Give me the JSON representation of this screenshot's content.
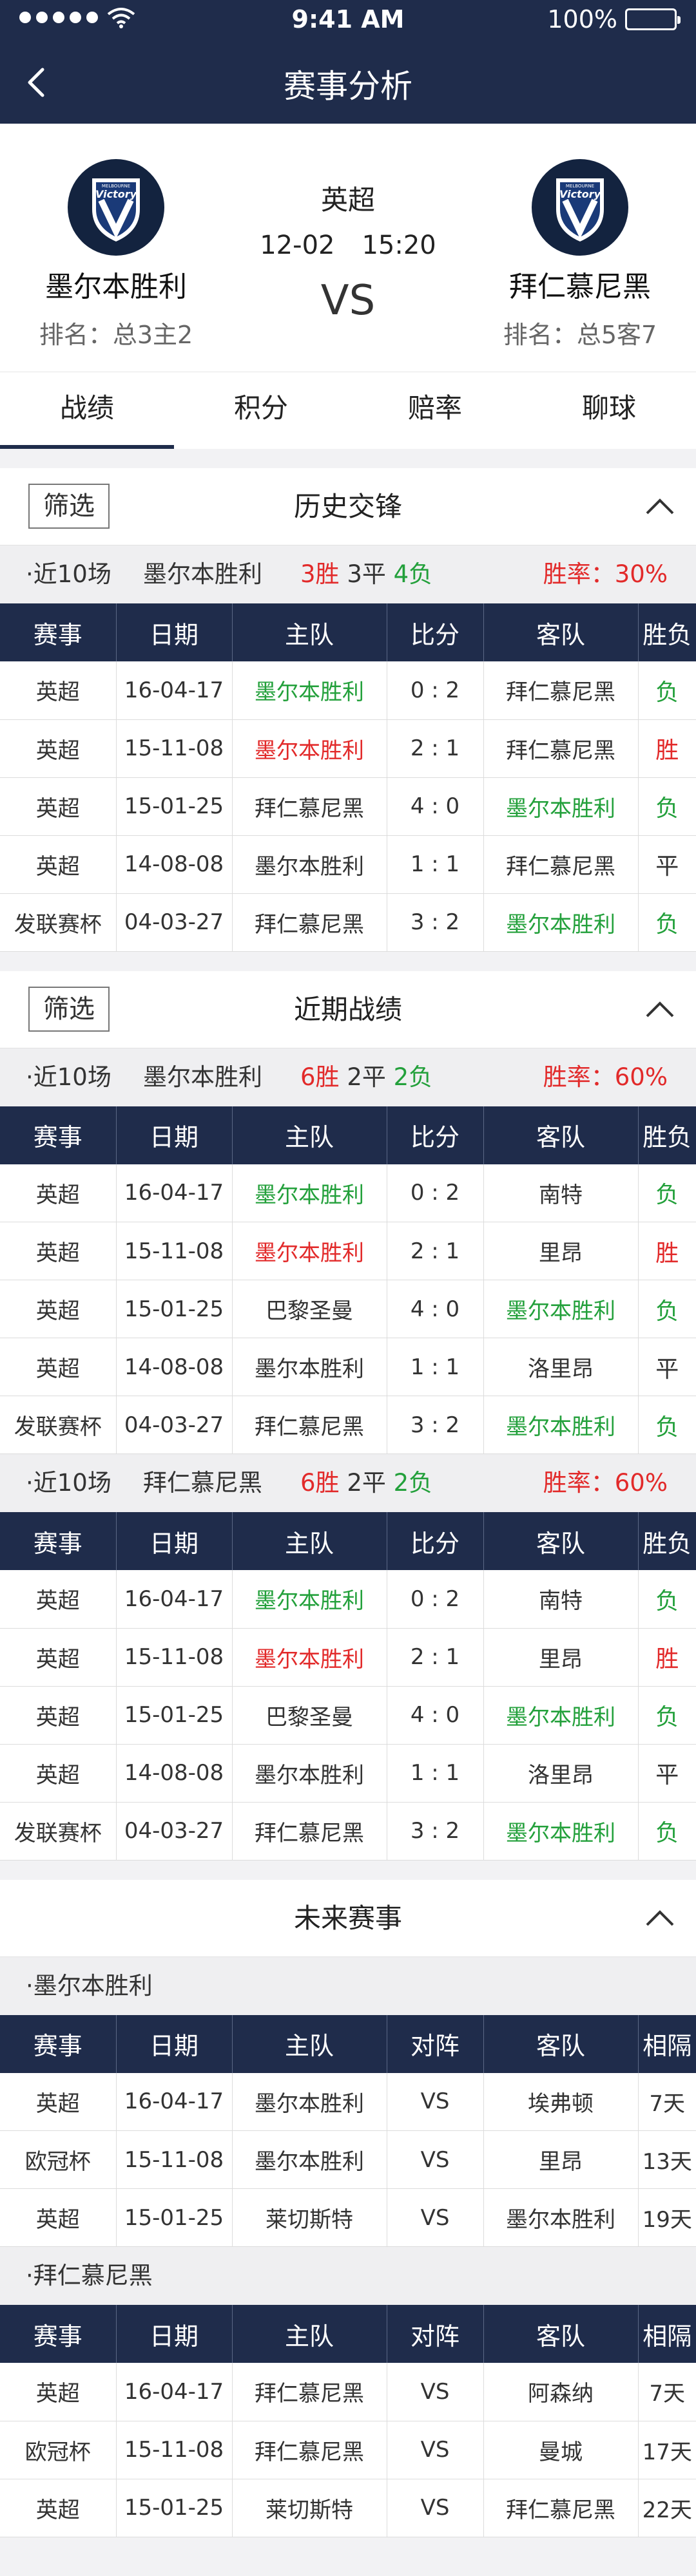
{
  "status_bar": {
    "time": "9:41 AM",
    "battery": "100%"
  },
  "nav": {
    "title": "赛事分析"
  },
  "match": {
    "home": {
      "name": "墨尔本胜利",
      "rank": "排名：总3主2",
      "logo_text": "Victory",
      "logo_small": "MELBOURNE"
    },
    "away": {
      "name": "拜仁慕尼黑",
      "rank": "排名：总5客7",
      "logo_text": "Victory",
      "logo_small": "MELBOURNE"
    },
    "league": "英超",
    "date": "12-02",
    "time": "15:20",
    "vs": "VS"
  },
  "tabs": [
    "战绩",
    "积分",
    "赔率",
    "聊球"
  ],
  "filter_label": "筛选",
  "colors": {
    "navy": "#1f2c4b",
    "win": "#e22a2a",
    "lose": "#23a03b"
  },
  "history": {
    "title": "历史交锋",
    "summary": {
      "last": "·近10场",
      "team": "墨尔本胜利",
      "w": "3胜",
      "d": "3平",
      "l": "4负",
      "rate": "胜率：30%"
    },
    "headers": [
      "赛事",
      "日期",
      "主队",
      "比分",
      "客队",
      "胜负"
    ],
    "rows": [
      {
        "league": "英超",
        "date": "16-04-17",
        "home": "墨尔本胜利",
        "home_c": "lose",
        "score": "0 : 2",
        "away": "拜仁慕尼黑",
        "away_c": "",
        "result": "负",
        "res_c": "lose"
      },
      {
        "league": "英超",
        "date": "15-11-08",
        "home": "墨尔本胜利",
        "home_c": "win",
        "score": "2 : 1",
        "away": "拜仁慕尼黑",
        "away_c": "",
        "result": "胜",
        "res_c": "win"
      },
      {
        "league": "英超",
        "date": "15-01-25",
        "home": "拜仁慕尼黑",
        "home_c": "",
        "score": "4 : 0",
        "away": "墨尔本胜利",
        "away_c": "lose",
        "result": "负",
        "res_c": "lose"
      },
      {
        "league": "英超",
        "date": "14-08-08",
        "home": "墨尔本胜利",
        "home_c": "",
        "score": "1 : 1",
        "away": "拜仁慕尼黑",
        "away_c": "",
        "result": "平",
        "res_c": "draw"
      },
      {
        "league": "发联赛杯",
        "date": "04-03-27",
        "home": "拜仁慕尼黑",
        "home_c": "",
        "score": "3 : 2",
        "away": "墨尔本胜利",
        "away_c": "lose",
        "result": "负",
        "res_c": "lose"
      }
    ]
  },
  "recent": {
    "title": "近期战绩",
    "groups": [
      {
        "summary": {
          "last": "·近10场",
          "team": "墨尔本胜利",
          "w": "6胜",
          "d": "2平",
          "l": "2负",
          "rate": "胜率：60%"
        },
        "headers": [
          "赛事",
          "日期",
          "主队",
          "比分",
          "客队",
          "胜负"
        ],
        "rows": [
          {
            "league": "英超",
            "date": "16-04-17",
            "home": "墨尔本胜利",
            "home_c": "lose",
            "score": "0 : 2",
            "away": "南特",
            "away_c": "",
            "result": "负",
            "res_c": "lose"
          },
          {
            "league": "英超",
            "date": "15-11-08",
            "home": "墨尔本胜利",
            "home_c": "win",
            "score": "2 : 1",
            "away": "里昂",
            "away_c": "",
            "result": "胜",
            "res_c": "win"
          },
          {
            "league": "英超",
            "date": "15-01-25",
            "home": "巴黎圣曼",
            "home_c": "",
            "score": "4 : 0",
            "away": "墨尔本胜利",
            "away_c": "lose",
            "result": "负",
            "res_c": "lose"
          },
          {
            "league": "英超",
            "date": "14-08-08",
            "home": "墨尔本胜利",
            "home_c": "",
            "score": "1 : 1",
            "away": "洛里昂",
            "away_c": "",
            "result": "平",
            "res_c": "draw"
          },
          {
            "league": "发联赛杯",
            "date": "04-03-27",
            "home": "拜仁慕尼黑",
            "home_c": "",
            "score": "3 : 2",
            "away": "墨尔本胜利",
            "away_c": "lose",
            "result": "负",
            "res_c": "lose"
          }
        ]
      },
      {
        "summary": {
          "last": "·近10场",
          "team": "拜仁慕尼黑",
          "w": "6胜",
          "d": "2平",
          "l": "2负",
          "rate": "胜率：60%"
        },
        "headers": [
          "赛事",
          "日期",
          "主队",
          "比分",
          "客队",
          "胜负"
        ],
        "rows": [
          {
            "league": "英超",
            "date": "16-04-17",
            "home": "墨尔本胜利",
            "home_c": "lose",
            "score": "0 : 2",
            "away": "南特",
            "away_c": "",
            "result": "负",
            "res_c": "lose"
          },
          {
            "league": "英超",
            "date": "15-11-08",
            "home": "墨尔本胜利",
            "home_c": "win",
            "score": "2 : 1",
            "away": "里昂",
            "away_c": "",
            "result": "胜",
            "res_c": "win"
          },
          {
            "league": "英超",
            "date": "15-01-25",
            "home": "巴黎圣曼",
            "home_c": "",
            "score": "4 : 0",
            "away": "墨尔本胜利",
            "away_c": "lose",
            "result": "负",
            "res_c": "lose"
          },
          {
            "league": "英超",
            "date": "14-08-08",
            "home": "墨尔本胜利",
            "home_c": "",
            "score": "1 : 1",
            "away": "洛里昂",
            "away_c": "",
            "result": "平",
            "res_c": "draw"
          },
          {
            "league": "发联赛杯",
            "date": "04-03-27",
            "home": "拜仁慕尼黑",
            "home_c": "",
            "score": "3 : 2",
            "away": "墨尔本胜利",
            "away_c": "lose",
            "result": "负",
            "res_c": "lose"
          }
        ]
      }
    ]
  },
  "future": {
    "title": "未来赛事",
    "groups": [
      {
        "label": "·墨尔本胜利",
        "headers": [
          "赛事",
          "日期",
          "主队",
          "对阵",
          "客队",
          "相隔"
        ],
        "rows": [
          {
            "league": "英超",
            "date": "16-04-17",
            "home": "墨尔本胜利",
            "vs": "VS",
            "away": "埃弗顿",
            "gap": "7天"
          },
          {
            "league": "欧冠杯",
            "date": "15-11-08",
            "home": "墨尔本胜利",
            "vs": "VS",
            "away": "里昂",
            "gap": "13天"
          },
          {
            "league": "英超",
            "date": "15-01-25",
            "home": "莱切斯特",
            "vs": "VS",
            "away": "墨尔本胜利",
            "gap": "19天"
          }
        ]
      },
      {
        "label": "·拜仁慕尼黑",
        "headers": [
          "赛事",
          "日期",
          "主队",
          "对阵",
          "客队",
          "相隔"
        ],
        "rows": [
          {
            "league": "英超",
            "date": "16-04-17",
            "home": "拜仁慕尼黑",
            "vs": "VS",
            "away": "阿森纳",
            "gap": "7天"
          },
          {
            "league": "欧冠杯",
            "date": "15-11-08",
            "home": "拜仁慕尼黑",
            "vs": "VS",
            "away": "曼城",
            "gap": "17天"
          },
          {
            "league": "英超",
            "date": "15-01-25",
            "home": "莱切斯特",
            "vs": "VS",
            "away": "拜仁慕尼黑",
            "gap": "22天"
          }
        ]
      }
    ]
  }
}
